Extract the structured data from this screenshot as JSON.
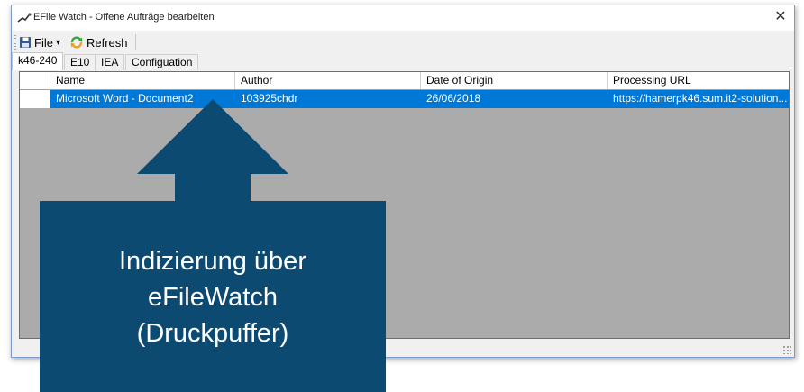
{
  "window": {
    "title": "EFile Watch - Offene Aufträge bearbeiten",
    "close_glyph": "✕"
  },
  "toolbar": {
    "file_label": "File",
    "file_caret": "▾",
    "refresh_label": "Refresh"
  },
  "tabs": [
    {
      "label": "k46-240",
      "active": true
    },
    {
      "label": "E10",
      "active": false
    },
    {
      "label": "IEA",
      "active": false
    },
    {
      "label": "Configuation",
      "active": false
    }
  ],
  "grid": {
    "columns": [
      "Name",
      "Author",
      "Date of Origin",
      "Processing URL"
    ],
    "rows": [
      {
        "indicator": "►",
        "name": "Microsoft Word - Document2",
        "author": "103925chdr",
        "date": "26/06/2018",
        "url": "https://hamerpk46.sum.it2-solution..."
      }
    ]
  },
  "callout": {
    "line1": "Indizierung über",
    "line2": "eFileWatch",
    "line3": "(Druckpuffer)",
    "color": "#0c4a72"
  },
  "colors": {
    "selection": "#0078d7",
    "grid_background": "#ababab"
  },
  "icons": {
    "app": "efile-watch-icon",
    "file": "floppy-disk-icon",
    "refresh": "refresh-icon",
    "close": "close-icon",
    "row_indicator": "triangle-right-icon",
    "size_grip": "size-grip-icon"
  }
}
